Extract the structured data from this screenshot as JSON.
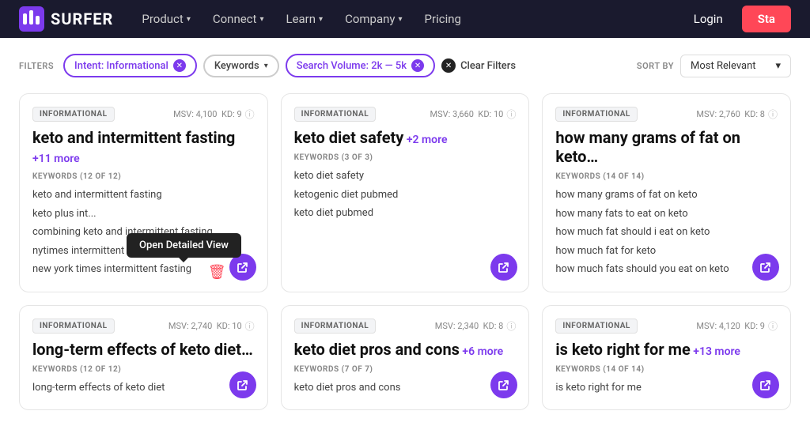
{
  "nav": {
    "logo_text": "SURFER",
    "items": [
      {
        "label": "Product",
        "has_dropdown": true
      },
      {
        "label": "Connect",
        "has_dropdown": true
      },
      {
        "label": "Learn",
        "has_dropdown": true
      },
      {
        "label": "Company",
        "has_dropdown": true
      },
      {
        "label": "Pricing",
        "has_dropdown": false
      }
    ],
    "login_label": "Login",
    "start_label": "Sta"
  },
  "filters": {
    "label": "FILTERS",
    "pills": [
      {
        "id": "intent",
        "text": "Intent: Informational",
        "removable": true
      },
      {
        "id": "keywords",
        "text": "Keywords",
        "has_dropdown": true
      },
      {
        "id": "search_volume",
        "text": "Search Volume: 2k — 5k",
        "removable": true
      }
    ],
    "clear_label": "Clear Filters"
  },
  "sort": {
    "label": "SORT BY",
    "value": "Most Relevant"
  },
  "tooltip": {
    "text": "Open Detailed View"
  },
  "cards": [
    {
      "badge": "INFORMATIONAL",
      "msv": "4,100",
      "kd": "9",
      "title": "keto and intermittent fasting",
      "more": "+11 more",
      "keywords_label": "KEYWORDS (12 OF 12)",
      "keywords": [
        "keto and intermittent fasting",
        "keto plus int...",
        "combining keto and intermittent fasting",
        "nytimes intermittent fasting",
        "new york times intermittent fasting"
      ],
      "has_tooltip": true
    },
    {
      "badge": "INFORMATIONAL",
      "msv": "3,660",
      "kd": "10",
      "title": "keto diet safety",
      "more": "+2 more",
      "keywords_label": "KEYWORDS (3 OF 3)",
      "keywords": [
        "keto diet safety",
        "ketogenic diet pubmed",
        "keto diet pubmed"
      ],
      "has_tooltip": false
    },
    {
      "badge": "INFORMATIONAL",
      "msv": "2,760",
      "kd": "8",
      "title": "how many grams of fat on keto…",
      "more": "",
      "keywords_label": "KEYWORDS (14 OF 14)",
      "keywords": [
        "how many grams of fat on keto",
        "how many fats to eat on keto",
        "how much fat should i eat on keto",
        "how much fat for keto",
        "how much fats should you eat on keto"
      ],
      "has_tooltip": false
    },
    {
      "badge": "INFORMATIONAL",
      "msv": "2,740",
      "kd": "10",
      "title": "long-term effects of keto diet…",
      "more": "",
      "keywords_label": "KEYWORDS (12 OF 12)",
      "keywords": [
        "long-term effects of keto diet"
      ],
      "has_tooltip": false
    },
    {
      "badge": "INFORMATIONAL",
      "msv": "2,340",
      "kd": "8",
      "title": "keto diet pros and cons",
      "more": "+6 more",
      "keywords_label": "KEYWORDS (7 OF 7)",
      "keywords": [
        "keto diet pros and cons"
      ],
      "has_tooltip": false
    },
    {
      "badge": "INFORMATIONAL",
      "msv": "4,120",
      "kd": "9",
      "title": "is keto right for me",
      "more": "+13 more",
      "keywords_label": "KEYWORDS (14 OF 14)",
      "keywords": [
        "is keto right for me"
      ],
      "has_tooltip": false
    }
  ]
}
